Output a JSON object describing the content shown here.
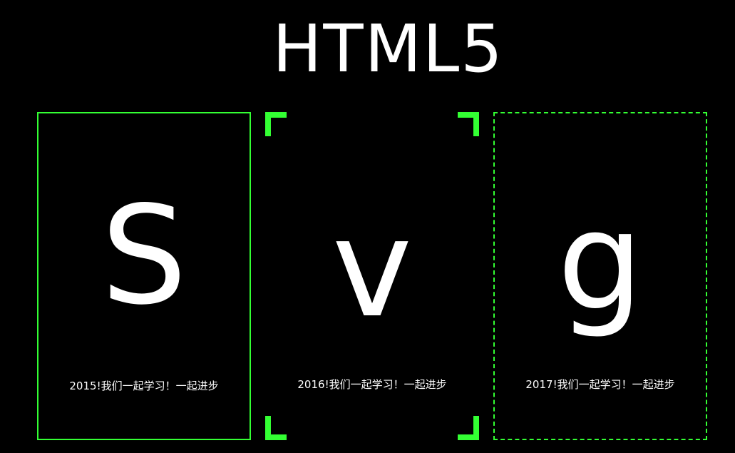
{
  "page": {
    "title": "HTML5"
  },
  "colors": {
    "background": "#000000",
    "accent": "#33ff33",
    "text": "#ffffff"
  },
  "cards": [
    {
      "letter": "S",
      "caption": "2015!我们一起学习！一起进步",
      "border_style": "solid"
    },
    {
      "letter": "v",
      "caption": "2016!我们一起学习！一起进步",
      "border_style": "corner-brackets"
    },
    {
      "letter": "g",
      "caption": "2017!我们一起学习！一起进步",
      "border_style": "dashed"
    }
  ]
}
